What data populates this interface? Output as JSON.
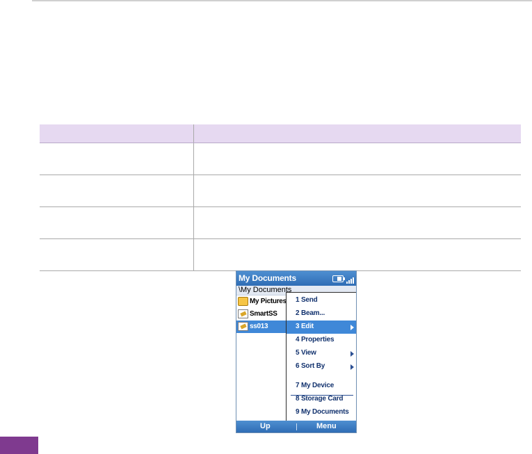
{
  "phone": {
    "title": "My Documents",
    "path": "\\My Documents",
    "files": [
      {
        "label": "My Pictures",
        "icon": "folder-icon",
        "selected": false
      },
      {
        "label": "SmartSS",
        "icon": "document-icon",
        "selected": false
      },
      {
        "label": "ss013",
        "icon": "document-icon",
        "selected": true
      }
    ],
    "menu": [
      {
        "label": "1 Send",
        "submenu": false
      },
      {
        "label": "2 Beam...",
        "submenu": false
      },
      {
        "label": "3 Edit",
        "submenu": true,
        "selected": true
      },
      {
        "label": "4 Properties",
        "submenu": false
      },
      {
        "label": "5 View",
        "submenu": true
      },
      {
        "label": "6 Sort By",
        "submenu": true
      },
      {
        "label": "7 My Device",
        "submenu": false
      },
      {
        "label": "8 Storage Card",
        "submenu": false
      },
      {
        "label": "9 My Documents",
        "submenu": false
      }
    ],
    "softkeys": {
      "left": "Up",
      "right": "Menu"
    }
  },
  "colors": {
    "accent": "#3f88d8",
    "header_row": "#e6d9f1",
    "page_tab": "#7f3a8f"
  }
}
